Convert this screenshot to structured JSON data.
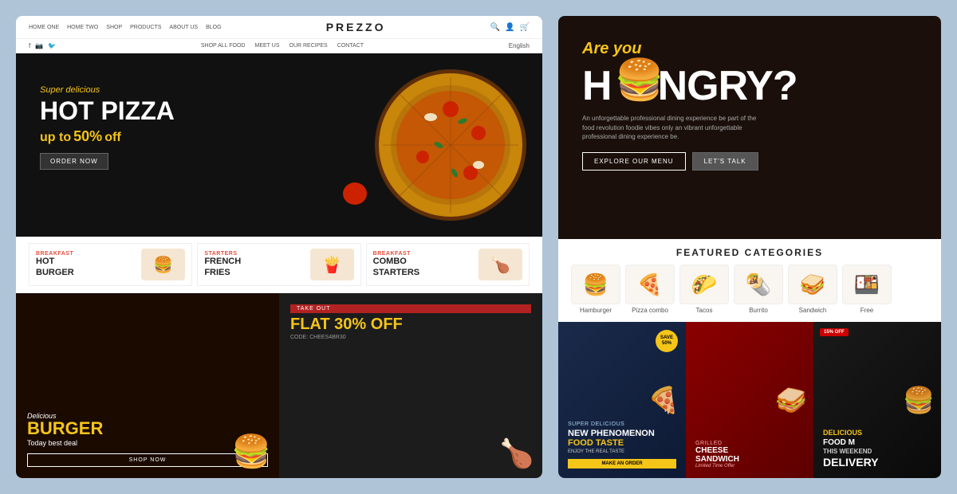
{
  "left": {
    "nav": {
      "links": [
        "HOME ONE",
        "HOME TWO",
        "SHOP",
        "PRODUCTS",
        "ABOUT US",
        "BLOG"
      ],
      "brand": "PREZZO",
      "secondary_links": [
        "SHOP ALL FOOD",
        "MEET US",
        "OUR RECIPES",
        "CONTACT"
      ],
      "lang": "English"
    },
    "hero": {
      "subtitle": "Super delicious",
      "title": "HOT PIZZA",
      "offer_prefix": "up to",
      "offer_percent": "50%",
      "offer_suffix": "off",
      "btn": "ORDER NOW"
    },
    "categories": [
      {
        "label": "BREAKFAST",
        "name": "HOT\nBURGER",
        "emoji": "🍔"
      },
      {
        "label": "STARTERS",
        "name": "FRENCH\nFRIES",
        "emoji": "🍟"
      },
      {
        "label": "BREAKFAST",
        "name": "COMBO\nSTARTERS",
        "emoji": "🍗"
      }
    ],
    "banner_burger": {
      "small": "Delicious",
      "big": "BURGER",
      "sub": "Today best deal",
      "btn": "SHOP NOW"
    },
    "banner_takeout": {
      "tag": "TAKE OUT",
      "title_white": "FLAT ",
      "title_yellow": "30%",
      "title_end": " OFF",
      "code": "CODE: CHEES4BR30"
    }
  },
  "right": {
    "hungry": {
      "areyou": "Are you",
      "title": "H  NGRY?",
      "desc": "An unforgettable professional dining experience be part of the food revolution foodie vibes only an vibrant unforgettable professional dining experience be.",
      "btn1": "EXPLORE OUR MENU",
      "btn2": "LET'S TALK"
    },
    "featured": {
      "title": "FEATURED CATEGORIES",
      "cats": [
        {
          "label": "Hamburger",
          "emoji": "🍔"
        },
        {
          "label": "Pizza combo",
          "emoji": "🍕"
        },
        {
          "label": "Tacos",
          "emoji": "🌮"
        },
        {
          "label": "Burrito",
          "emoji": "🌯"
        },
        {
          "label": "Sandwich",
          "emoji": "🥪"
        },
        {
          "label": "Free",
          "emoji": "🍱"
        }
      ]
    },
    "promos": [
      {
        "subtitle": "Super Delicious",
        "title_line1": "NEW PHENOMENON",
        "title_line2": "FOOD TASTE",
        "desc": "ENJOY THE REAL TASTE",
        "btn": "MAKE AN ORDER",
        "save": "SAVE\n50%",
        "emoji": "🍕",
        "bg": "card1"
      },
      {
        "subtitle": "Grilled",
        "title_line1": "CHEESE",
        "title_line2": "SANDWICH",
        "desc": "Limited Time Offer",
        "emoji": "🥪",
        "bg": "card2"
      },
      {
        "subtitle": "Delicious",
        "title_line1": "FOOD M",
        "title_line2": "THIS WEEKEND",
        "desc": "DELIVERY",
        "off": "15% OFF",
        "emoji": "🍔",
        "bg": "card3"
      }
    ]
  }
}
